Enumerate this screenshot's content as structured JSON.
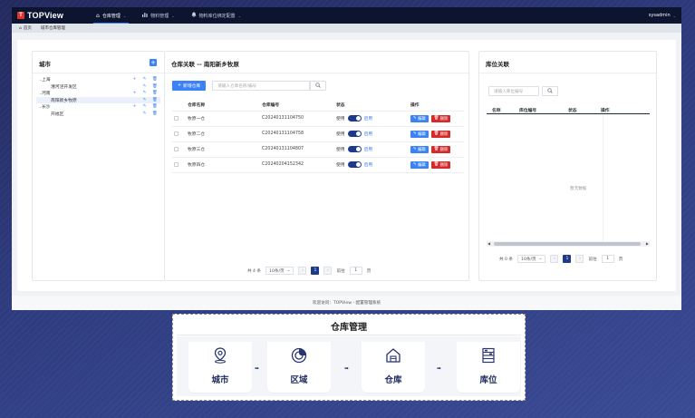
{
  "app": {
    "logo": "TOPView",
    "menu": [
      {
        "label": "仓库管理",
        "icon": "home-icon",
        "active": true
      },
      {
        "label": "物料管理",
        "icon": "bar-chart-icon",
        "active": false
      },
      {
        "label": "物料库位绑定配置",
        "icon": "bell-icon",
        "active": false
      }
    ],
    "user": "sysadmin"
  },
  "breadcrumb": [
    "首页",
    "城市仓库管理"
  ],
  "city_panel": {
    "title": "城市",
    "tree": [
      {
        "label": "上海",
        "level": 1,
        "expanded": true
      },
      {
        "label": "漕河泾开发区",
        "level": 2
      },
      {
        "label": "河南",
        "level": 1,
        "expanded": true
      },
      {
        "label": "南阳新乡牧原",
        "level": 2,
        "selected": true
      },
      {
        "label": "长沙",
        "level": 1,
        "expanded": true
      },
      {
        "label": "开福区",
        "level": 2
      }
    ]
  },
  "warehouse_panel": {
    "title": "仓库关联 -- 南阳新乡牧原",
    "add_button": "新增仓库",
    "search_placeholder": "请输入仓库名称/编号",
    "columns": [
      "仓库名称",
      "仓库编号",
      "状态",
      "操作"
    ],
    "rows": [
      {
        "name": "牧原一仓",
        "code": "C20240131104750",
        "status_label": "使用",
        "status_text": "启用"
      },
      {
        "name": "牧原二仓",
        "code": "C20240131104758",
        "status_label": "使用",
        "status_text": "启用"
      },
      {
        "name": "牧原三仓",
        "code": "C20240131104807",
        "status_label": "使用",
        "status_text": "启用"
      },
      {
        "name": "牧原四仓",
        "code": "C20240204152342",
        "status_label": "使用",
        "status_text": "启用"
      }
    ],
    "edit_label": "编辑",
    "delete_label": "删除",
    "pager": {
      "total": "共 4 条",
      "page_size": "10条/页",
      "current": "1",
      "goto_label": "前往",
      "goto_value": "1",
      "page_unit": "页"
    }
  },
  "location_panel": {
    "title": "库位关联",
    "search_placeholder": "请输入库位编号",
    "columns": [
      "名称",
      "库位编号",
      "状态",
      "操作"
    ],
    "empty_text": "暂无数据",
    "pager": {
      "total": "共 0 条",
      "page_size": "10条/页",
      "current": "1",
      "goto_label": "前往",
      "goto_value": "1",
      "page_unit": "页"
    }
  },
  "footer": "欢迎访问：TOPView - 配置管理系统",
  "flow": {
    "title": "仓库管理",
    "steps": [
      {
        "label": "城市",
        "icon": "location-pin-icon"
      },
      {
        "label": "区域",
        "icon": "target-icon"
      },
      {
        "label": "仓库",
        "icon": "warehouse-icon"
      },
      {
        "label": "库位",
        "icon": "shelf-icon"
      }
    ]
  }
}
